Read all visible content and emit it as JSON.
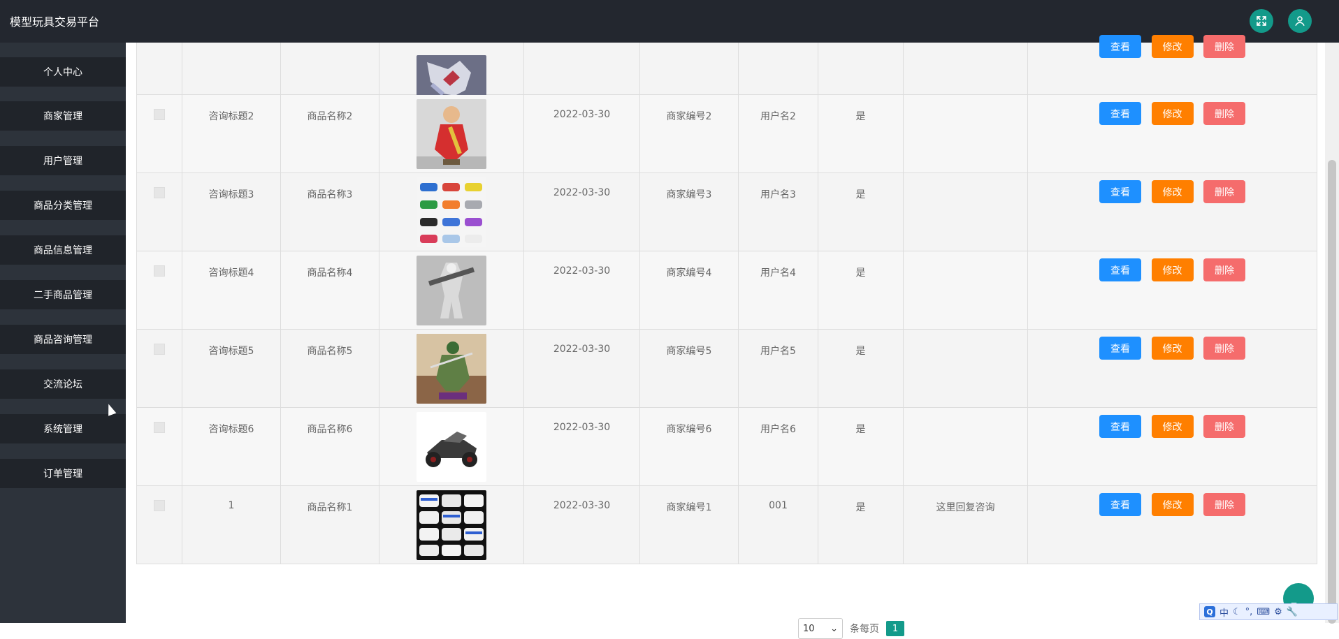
{
  "app": {
    "title": "模型玩具交易平台"
  },
  "sidebar": {
    "items": [
      {
        "label": "个人中心"
      },
      {
        "label": "商家管理"
      },
      {
        "label": "用户管理"
      },
      {
        "label": "商品分类管理"
      },
      {
        "label": "商品信息管理"
      },
      {
        "label": "二手商品管理"
      },
      {
        "label": "商品咨询管理"
      },
      {
        "label": "交流论坛"
      },
      {
        "label": "系统管理"
      },
      {
        "label": "订单管理"
      }
    ]
  },
  "table": {
    "rows": [
      {
        "title": "",
        "product": "",
        "date": "",
        "merchant": "",
        "user": "",
        "replied": "",
        "reply": "",
        "partial": true
      },
      {
        "title": "咨询标题2",
        "product": "商品名称2",
        "date": "2022-03-30",
        "merchant": "商家编号2",
        "user": "用户名2",
        "replied": "是",
        "reply": ""
      },
      {
        "title": "咨询标题3",
        "product": "商品名称3",
        "date": "2022-03-30",
        "merchant": "商家编号3",
        "user": "用户名3",
        "replied": "是",
        "reply": ""
      },
      {
        "title": "咨询标题4",
        "product": "商品名称4",
        "date": "2022-03-30",
        "merchant": "商家编号4",
        "user": "用户名4",
        "replied": "是",
        "reply": ""
      },
      {
        "title": "咨询标题5",
        "product": "商品名称5",
        "date": "2022-03-30",
        "merchant": "商家编号5",
        "user": "用户名5",
        "replied": "是",
        "reply": ""
      },
      {
        "title": "咨询标题6",
        "product": "商品名称6",
        "date": "2022-03-30",
        "merchant": "商家编号6",
        "user": "用户名6",
        "replied": "是",
        "reply": ""
      },
      {
        "title": "1",
        "product": "商品名称1",
        "date": "2022-03-30",
        "merchant": "商家编号1",
        "user": "001",
        "replied": "是",
        "reply": "这里回复咨询"
      }
    ],
    "buttons": {
      "view": "查看",
      "edit": "修改",
      "delete": "删除"
    }
  },
  "pagination": {
    "page_size": "10",
    "per_page_label": "条每页",
    "current_page": "1"
  },
  "top_button": {
    "label": "Top"
  },
  "ime": {
    "logo": "Q",
    "lang": "中",
    "punct": "°,"
  },
  "colors": {
    "header": "#23272f",
    "sidebar": "#2d333b",
    "accent": "#139a8a",
    "view": "#1e90ff",
    "edit": "#ff7f00",
    "delete": "#f56c6c"
  }
}
